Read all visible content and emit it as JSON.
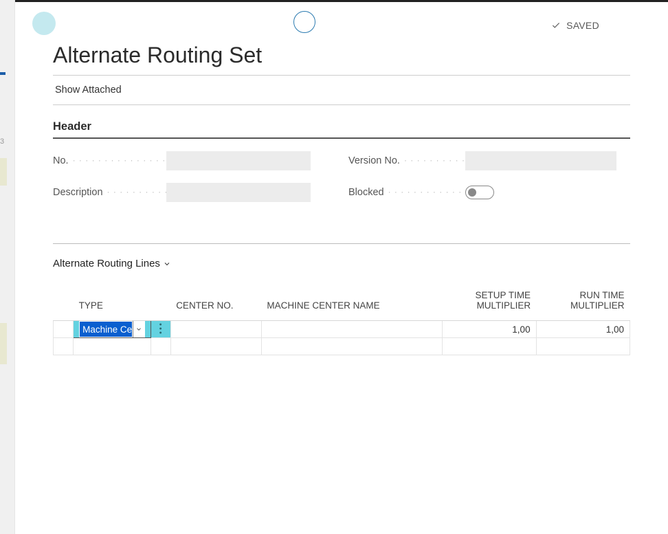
{
  "status_label": "SAVED",
  "page_title": "Alternate Routing Set",
  "actions": {
    "show_attached": "Show Attached"
  },
  "section_header": "Header",
  "fields": {
    "no_label": "No.",
    "no_value": "",
    "description_label": "Description",
    "description_value": "",
    "version_label": "Version No.",
    "version_value": "",
    "blocked_label": "Blocked",
    "blocked_value": false
  },
  "lines_section_title": "Alternate Routing Lines",
  "columns": {
    "type": "TYPE",
    "center_no": "CENTER NO.",
    "machine_center_name": "MACHINE CENTER NAME",
    "setup_time_mult": "SETUP TIME MULTIPLIER",
    "run_time_mult": "RUN TIME MULTIPLIER"
  },
  "rows": {
    "r1": {
      "type": "Machine Cen",
      "center_no": "",
      "machine_center_name": "",
      "setup_time_mult": "1,00",
      "run_time_mult": "1,00"
    }
  }
}
